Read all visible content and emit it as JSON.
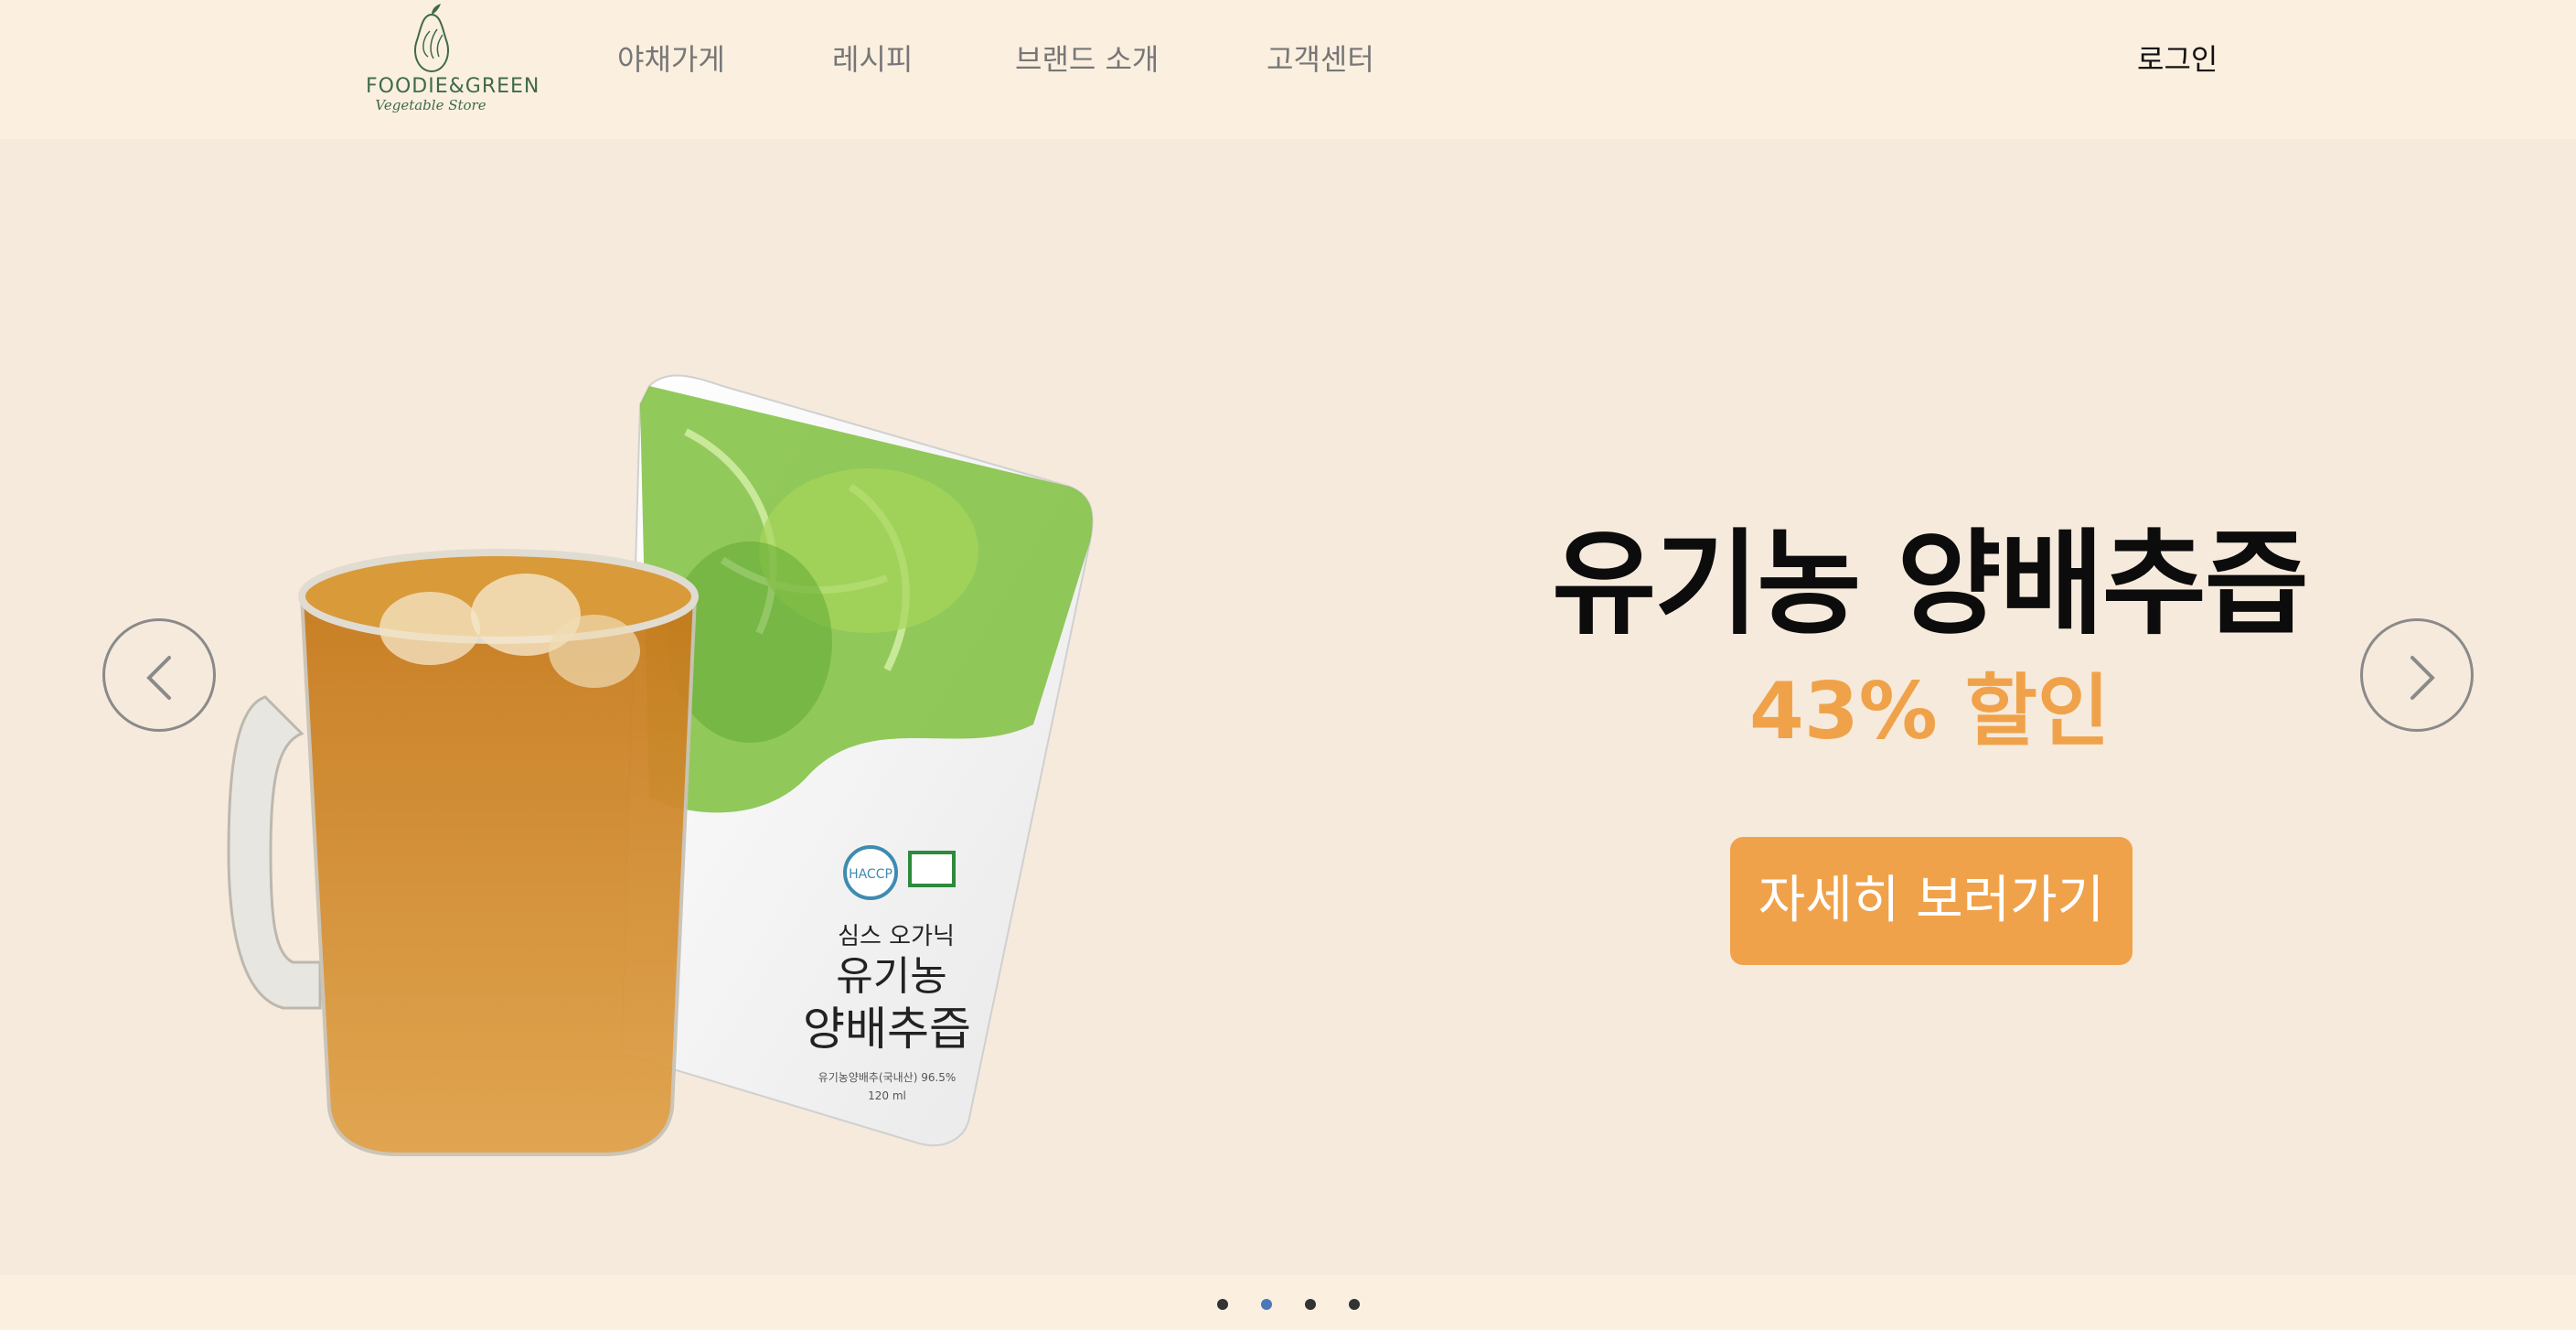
{
  "brand": {
    "name": "FOODIE&GREEN",
    "tagline": "Vegetable Store"
  },
  "nav": {
    "items": [
      {
        "label": "야채가게"
      },
      {
        "label": "레시피"
      },
      {
        "label": "브랜드 소개"
      },
      {
        "label": "고객센터"
      }
    ],
    "login_label": "로그인"
  },
  "hero": {
    "headline": "유기농 양배추즙",
    "discount": "43% 할인",
    "cta_label": "자세히 보러가기",
    "product_pouch_text": {
      "maker": "심스 오가닉",
      "line1": "유기농",
      "line2": "양배추즙",
      "badge_haccp": "HACCP",
      "small_print": "유기농양배추(국내산) 96.5%",
      "volume": "120 ml"
    }
  },
  "carousel": {
    "slide_count": 4,
    "active_index": 1
  },
  "colors": {
    "header_bg": "#fbefe0",
    "hero_bg": "#f6eadc",
    "accent_orange": "#f0a24a",
    "active_dot": "#4a78b8",
    "brand_green": "#3f6a4a"
  },
  "icons": {
    "prev": "chevron-left-icon",
    "next": "chevron-right-icon",
    "logo": "avocado-logo-icon"
  }
}
